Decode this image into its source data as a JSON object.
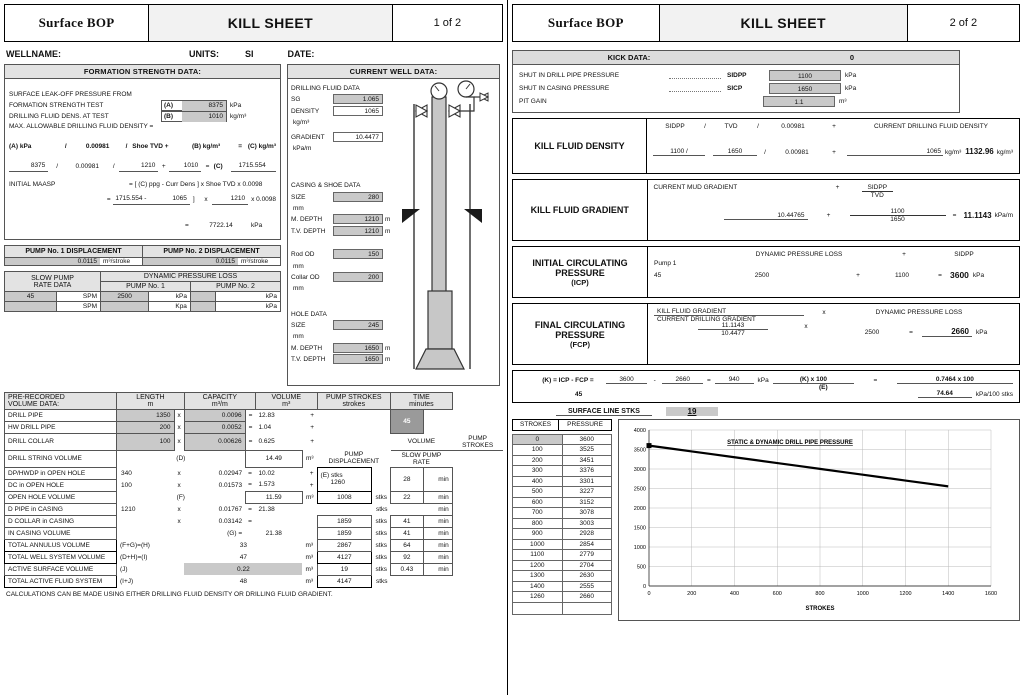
{
  "page1": {
    "titlebar": {
      "bop": "Surface BOP",
      "title": "KILL SHEET",
      "page": "1 of 2"
    },
    "header": {
      "wellname": "WELLNAME:",
      "units": "UNITS:",
      "units_value": "SI",
      "date": "DATE:"
    },
    "formation": {
      "heading": "FORMATION STRENGTH DATA:",
      "line1": "SURFACE LEAK-OFF PRESSURE FROM",
      "line2": "FORMATION STRENGTH TEST",
      "tagA": "(A)",
      "valA": "8375",
      "unitA": "kPa",
      "line3": "DRILLING FLUID DENS. AT TEST",
      "tagB": "(B)",
      "valB": "1010",
      "unitB": "kg/m³",
      "line4": "MAX. ALLOWABLE DRILLING FLUID DENSITY =",
      "formula": {
        "a": "(A) kPa",
        "s1": "/",
        "c1": "0.00981",
        "s2": "/",
        "c2": "Shoe TVD +",
        "b": "(B) kg/m³",
        "eq": "=",
        "c": "(C) kg/m³"
      },
      "values": {
        "a": "8375",
        "s1": "/",
        "c1": "0.00981",
        "s2": "/",
        "tvd": "1210",
        "plus": "+",
        "b": "1010",
        "eq": "=",
        "ctag": "(C)",
        "c": "1715.554"
      },
      "maasp_label": "INITIAL MAASP",
      "maasp_formula": "= [ (C) ppg   -   Curr Dens ]    x   Shoe TVD  x 0.0098",
      "maasp_v1": "1715.554 -",
      "maasp_v2": "1065",
      "maasp_brk": "]",
      "maasp_x": "x",
      "maasp_v3": "1210",
      "maasp_x2": "x 0.0098",
      "maasp_eq": "=",
      "maasp_result": "7722.14",
      "maasp_unit": "kPa"
    },
    "pump_displacement": {
      "p1_head": "PUMP No. 1 DISPLACEMENT",
      "p1_val": "0.0115",
      "p1_unit": "m³/stroke",
      "p2_head": "PUMP No. 2 DISPLACEMENT",
      "p2_val": "0.0115",
      "p2_unit": "m³/stroke"
    },
    "slow_pump": {
      "head1": "SLOW PUMP",
      "head2": "RATE DATA",
      "dpl": "DYNAMIC PRESSURE LOSS",
      "pump1": "PUMP No. 1",
      "pump2": "PUMP No. 2",
      "row1": {
        "spm": "45",
        "spm_u": "SPM",
        "p1": "2500",
        "p1_u": "kPa",
        "p2": "",
        "p2_u": "kPa"
      },
      "row2": {
        "spm": "",
        "spm_u": "SPM",
        "p1": "",
        "p1_u": "Kpa",
        "p2": "",
        "p2_u": "kPa"
      }
    },
    "current_well": {
      "heading": "CURRENT WELL DATA:",
      "fluid_head": "DRILLING FLUID DATA",
      "sg_l": "SG",
      "sg_v": "1.065",
      "den_l": "DENSITY",
      "den_v": "1065",
      "den_u": "kg/m³",
      "grad_l": "GRADIENT",
      "grad_v": "10.4477",
      "grad_u": "kPa/m",
      "casing_head": "CASING & SHOE DATA",
      "c_size_l": "SIZE",
      "c_size_v": "280",
      "c_size_u": "mm",
      "c_md_l": "M. DEPTH",
      "c_md_v": "1210",
      "c_md_u": "m",
      "c_tvd_l": "T.V. DEPTH",
      "c_tvd_v": "1210",
      "c_tvd_u": "m",
      "rod_l": "Rod OD",
      "rod_v": "150",
      "rod_u": "mm",
      "collar_l": "Collar OD",
      "collar_v": "200",
      "collar_u": "mm",
      "hole_head": "HOLE DATA",
      "h_size_l": "SIZE",
      "h_size_v": "245",
      "h_size_u": "mm",
      "h_md_l": "M. DEPTH",
      "h_md_v": "1650",
      "h_md_u": "m",
      "h_tvd_l": "T.V. DEPTH",
      "h_tvd_v": "1650",
      "h_tvd_u": "m"
    },
    "volume_table": {
      "head_label1": "PRE-RECORDED",
      "head_label2": "VOLUME DATA:",
      "col_length1": "LENGTH",
      "col_length2": "m",
      "col_capacity1": "CAPACITY",
      "col_capacity2": "m³/m",
      "col_volume1": "VOLUME",
      "col_volume2": "m³",
      "col_strokes1": "PUMP STROKES",
      "col_strokes2": "strokes",
      "col_time1": "TIME",
      "col_time2": "minutes",
      "rows": [
        {
          "label": "DRILL PIPE",
          "length": "1350",
          "cap": "0.0096",
          "vol": "12.83"
        },
        {
          "label": "HW DRILL PIPE",
          "length": "200",
          "cap": "0.0052",
          "vol": "1.04"
        },
        {
          "label": "DRILL COLLAR",
          "length": "100",
          "cap": "0.00626",
          "vol": "0.625"
        }
      ],
      "dsv_label": "DRILL STRING VOLUME",
      "dsv_tag": "(D)",
      "dsv_val": "14.49",
      "dsv_unit": "m³",
      "oh_rows": [
        {
          "label": "DP/HWDP in OPEN HOLE",
          "length": "340",
          "cap": "0.02947",
          "vol": "10.02"
        },
        {
          "label": "DC in OPEN HOLE",
          "length": "100",
          "cap": "0.01573",
          "vol": "1.573"
        }
      ],
      "ohv_label": "OPEN HOLE VOLUME",
      "ohv_tag": "(F)",
      "ohv_val": "11.59",
      "ohv_unit": "m³",
      "cs_rows": [
        {
          "label": "D PIPE in CASING",
          "length": "1210",
          "cap": "0.01767",
          "vol": "21.38"
        },
        {
          "label": "D COLLAR in CASING",
          "length": "",
          "cap": "0.03142",
          "vol": ""
        }
      ],
      "icv_label": "IN CASING VOLUME",
      "icv_tag": "(G) =",
      "icv_val": "21.38",
      "totals": [
        {
          "label": "TOTAL ANNULUS VOLUME",
          "tag": "(F+G)=(H)",
          "val": "33",
          "unit": "m³",
          "strong": true
        },
        {
          "label": "TOTAL WELL SYSTEM VOLUME",
          "tag": "(D+H)=(I)",
          "val": "47",
          "unit": "m³",
          "strong": true
        },
        {
          "label": "ACTIVE SURFACE VOLUME",
          "tag": "(J)",
          "val": "0.22",
          "unit": "m³",
          "strong": false
        },
        {
          "label": "TOTAL ACTIVE FLUID SYSTEM",
          "tag": "(I+J)",
          "val": "48",
          "unit": "m³",
          "strong": true
        }
      ],
      "footnote": "CALCULATIONS CAN BE MADE USING EITHER DRILLING FLUID DENSITY OR DRILLING FLUID GRADIENT.",
      "strokes_col": {
        "time_top": "45",
        "frac1_top": "VOLUME",
        "frac1_bot": "PUMP DISPLACEMENT",
        "frac2_top": "PUMP STROKES",
        "frac2_bot": "SLOW PUMP RATE",
        "e_tag": "(E)  stks",
        "e_val": "1260",
        "e_time": "28",
        "e_time_u": "min",
        "ohv_stk": "1008",
        "ohv_stk_u": "stks",
        "ohv_time": "22",
        "ohv_time_u": "min",
        "rows": [
          {
            "stk": "",
            "u": "stks",
            "time": "",
            "tu": "min"
          },
          {
            "stk": "1859",
            "u": "stks",
            "time": "41",
            "tu": "min"
          },
          {
            "stk": "1859",
            "u": "stks",
            "time": "41",
            "tu": "min"
          },
          {
            "stk": "2867",
            "u": "stks",
            "time": "64",
            "tu": "min"
          },
          {
            "stk": "4127",
            "u": "stks",
            "time": "92",
            "tu": "min"
          },
          {
            "stk": "19",
            "u": "stks",
            "time": "0.43",
            "tu": "min"
          },
          {
            "stk": "4147",
            "u": "stks",
            "time": "",
            "tu": ""
          }
        ]
      }
    }
  },
  "page2": {
    "titlebar": {
      "bop": "Surface BOP",
      "title": "KILL SHEET",
      "page": "2 of 2"
    },
    "kick": {
      "heading": "KICK DATA:",
      "heading_value": "0",
      "rows": [
        {
          "label": "SHUT IN DRILL PIPE PRESSURE",
          "abbr": "SIDPP",
          "value": "1100",
          "unit": "kPa"
        },
        {
          "label": "SHUT IN CASING PRESSURE",
          "abbr": "SICP",
          "value": "1650",
          "unit": "kPa"
        },
        {
          "label": "PIT GAIN",
          "abbr": "",
          "value": "1.1",
          "unit": "m³"
        }
      ]
    },
    "kfd": {
      "name": "KILL FLUID DENSITY",
      "f_sidpp": "SIDPP",
      "f_s1": "/",
      "f_tvd": "TVD",
      "f_s2": "/",
      "f_const": "0.00981",
      "f_plus": "+",
      "f_cdfd": "CURRENT DRILLING FLUID DENSITY",
      "v_sidpp": "1100 /",
      "v_tvd": "1650",
      "v_s2": "/",
      "v_const": "0.00981",
      "v_plus": "+",
      "v_dens": "1065",
      "v_dens_u": "kg/m³",
      "result": "1132.96",
      "result_u": "kg/m³"
    },
    "kfg": {
      "name": "KILL FLUID GRADIENT",
      "f_cmg": "CURRENT MUD GRADIENT",
      "f_plus": "+",
      "f_top": "SIDPP",
      "f_bot": "TVD",
      "v_cmg": "10.44765",
      "v_plus": "+",
      "v_top": "1100",
      "v_bot": "1650",
      "v_eq": "=",
      "result": "11.1143",
      "result_u": "kPa/m"
    },
    "icp": {
      "name1": "INITIAL CIRCULATING",
      "name2": "PRESSURE",
      "name3": "(ICP)",
      "f_dpl": "DYNAMIC PRESSURE LOSS",
      "f_plus": "+",
      "f_sidpp": "SIDPP",
      "pump": "Pump 1",
      "spm": "45",
      "v_dpl": "2500",
      "v_plus": "+",
      "v_sidpp": "1100",
      "v_eq": "=",
      "result": "3600",
      "result_u": "kPa"
    },
    "fcp": {
      "name1": "FINAL CIRCULATING",
      "name2": "PRESSURE",
      "name3": "(FCP)",
      "f_top": "KILL FLUID GRADIENT",
      "f_bot": "CURRENT DRILLING GRADIENT",
      "f_x": "x",
      "f_dpl": "DYNAMIC PRESSURE LOSS",
      "v_top": "11.1143",
      "v_bot": "10.4477",
      "v_x": "x",
      "v_dpl": "2500",
      "v_eq": "=",
      "result": "2660",
      "result_u": "kPa"
    },
    "kcalc": {
      "lead": "(K) = ICP - FCP =",
      "icp": "3600",
      "minus": "-",
      "fcp": "2660",
      "eq1": "=",
      "k": "940",
      "k_u": "kPa",
      "knum": "(K) x 100",
      "kden": "(E)",
      "eq2": "=",
      "right": "0.7464 x 100",
      "spm": "45",
      "final": "74.64",
      "final_u": "kPa/100 stks"
    },
    "surface_line": {
      "label": "SURFACE LINE STKS",
      "value": "19"
    },
    "sp_table": {
      "col_strokes": "STROKES",
      "col_pressure": "PRESSURE",
      "rows": [
        {
          "s": "0",
          "p": "3600",
          "hl": true
        },
        {
          "s": "100",
          "p": "3525"
        },
        {
          "s": "200",
          "p": "3451"
        },
        {
          "s": "300",
          "p": "3376"
        },
        {
          "s": "400",
          "p": "3301"
        },
        {
          "s": "500",
          "p": "3227"
        },
        {
          "s": "600",
          "p": "3152"
        },
        {
          "s": "700",
          "p": "3078"
        },
        {
          "s": "800",
          "p": "3003"
        },
        {
          "s": "900",
          "p": "2928"
        },
        {
          "s": "1000",
          "p": "2854"
        },
        {
          "s": "1100",
          "p": "2779"
        },
        {
          "s": "1200",
          "p": "2704"
        },
        {
          "s": "1300",
          "p": "2630"
        },
        {
          "s": "1400",
          "p": "2555"
        },
        {
          "s": "1260",
          "p": "2660"
        }
      ]
    }
  },
  "chart_data": {
    "type": "line",
    "title": "STATIC & DYNAMIC DRILL PIPE PRESSURE",
    "xlabel": "STROKES",
    "ylabel": "",
    "xlim": [
      0,
      1600
    ],
    "ylim": [
      0,
      4000
    ],
    "xticks": [
      0,
      200,
      400,
      600,
      800,
      1000,
      1200,
      1400,
      1600
    ],
    "yticks": [
      0,
      500,
      1000,
      1500,
      2000,
      2500,
      3000,
      3500,
      4000
    ],
    "grid": true,
    "legend": false,
    "series": [
      {
        "name": "Drill pipe pressure",
        "x": [
          0,
          100,
          200,
          300,
          400,
          500,
          600,
          700,
          800,
          900,
          1000,
          1100,
          1200,
          1300,
          1400
        ],
        "y": [
          3600,
          3525,
          3451,
          3376,
          3301,
          3227,
          3152,
          3078,
          3003,
          2928,
          2854,
          2779,
          2704,
          2630,
          2555
        ]
      }
    ]
  }
}
